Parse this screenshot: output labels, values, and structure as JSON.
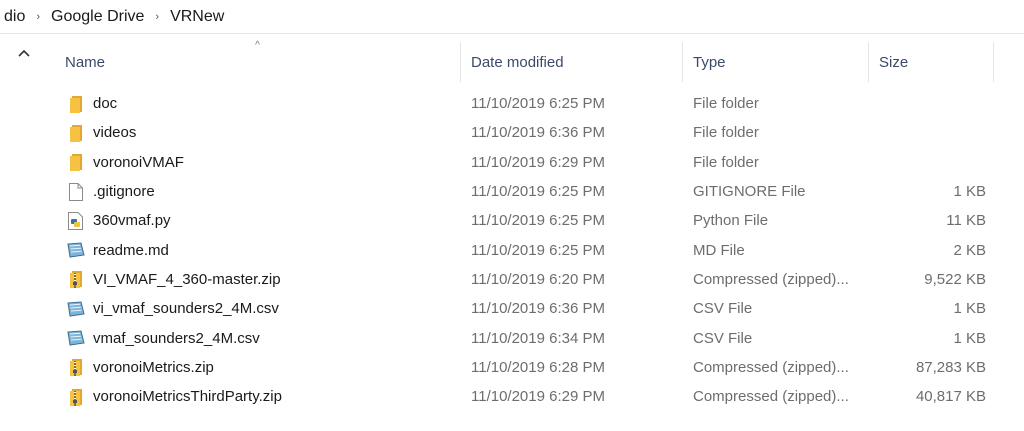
{
  "breadcrumb": {
    "items": [
      "dio",
      "Google Drive",
      "VRNew"
    ],
    "separator": "›"
  },
  "header": {
    "name": "Name",
    "date": "Date modified",
    "type": "Type",
    "size": "Size",
    "sort_indicator": "^"
  },
  "files": [
    {
      "name": "doc",
      "date": "11/10/2019 6:25 PM",
      "type": "File folder",
      "size": "",
      "icon": "folder-icon"
    },
    {
      "name": "videos",
      "date": "11/10/2019 6:36 PM",
      "type": "File folder",
      "size": "",
      "icon": "folder-icon"
    },
    {
      "name": "voronoiVMAF",
      "date": "11/10/2019 6:29 PM",
      "type": "File folder",
      "size": "",
      "icon": "folder-icon"
    },
    {
      "name": ".gitignore",
      "date": "11/10/2019 6:25 PM",
      "type": "GITIGNORE File",
      "size": "1 KB",
      "icon": "blank-file-icon"
    },
    {
      "name": "360vmaf.py",
      "date": "11/10/2019 6:25 PM",
      "type": "Python File",
      "size": "11 KB",
      "icon": "python-file-icon"
    },
    {
      "name": "readme.md",
      "date": "11/10/2019 6:25 PM",
      "type": "MD File",
      "size": "2 KB",
      "icon": "document-file-icon"
    },
    {
      "name": "VI_VMAF_4_360-master.zip",
      "date": "11/10/2019 6:20 PM",
      "type": "Compressed (zipped)...",
      "size": "9,522 KB",
      "icon": "zip-folder-icon"
    },
    {
      "name": "vi_vmaf_sounders2_4M.csv",
      "date": "11/10/2019 6:36 PM",
      "type": "CSV File",
      "size": "1 KB",
      "icon": "document-file-icon"
    },
    {
      "name": "vmaf_sounders2_4M.csv",
      "date": "11/10/2019 6:34 PM",
      "type": "CSV File",
      "size": "1 KB",
      "icon": "document-file-icon"
    },
    {
      "name": "voronoiMetrics.zip",
      "date": "11/10/2019 6:28 PM",
      "type": "Compressed (zipped)...",
      "size": "87,283 KB",
      "icon": "zip-folder-icon"
    },
    {
      "name": "voronoiMetricsThirdParty.zip",
      "date": "11/10/2019 6:29 PM",
      "type": "Compressed (zipped)...",
      "size": "40,817 KB",
      "icon": "zip-folder-icon"
    }
  ],
  "colors": {
    "folder": "#f5c242",
    "header_text": "#3b4a6b",
    "meta_text": "#6d6d6d"
  }
}
